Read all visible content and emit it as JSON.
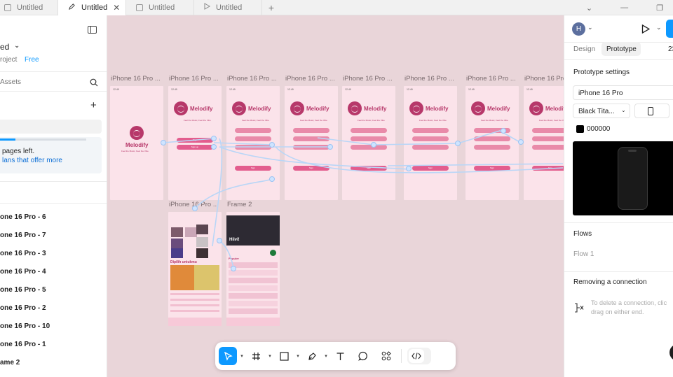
{
  "tabs": [
    {
      "label": "Untitled",
      "active": false,
      "icon": "draft-icon"
    },
    {
      "label": "Untitled",
      "active": true,
      "icon": "pen-icon"
    },
    {
      "label": "Untitled",
      "active": false,
      "icon": "draft-icon"
    },
    {
      "label": "Untitled",
      "active": false,
      "icon": "play-icon"
    }
  ],
  "left_panel": {
    "file_name": "ed",
    "project": "roject",
    "plan_badge": "Free",
    "assets_label": "Assets",
    "notice_line1": "pages left.",
    "notice_link": "lans that offer more",
    "layers": [
      "one 16 Pro - 6",
      "one 16 Pro - 7",
      "one 16 Pro - 3",
      "one 16 Pro - 4",
      "one 16 Pro - 5",
      "one 16 Pro - 2",
      "one 16 Pro - 10",
      "one 16 Pro - 1",
      "ame 2"
    ]
  },
  "canvas": {
    "frame_labels": [
      "iPhone 16 Pro ...",
      "iPhone 16 Pro ...",
      "iPhone 16 Pro ...",
      "iPhone 16 Pro ...",
      "iPhone 16 Pro ...",
      "iPhone 16 Pro ...",
      "iPhone 16 Pro ...",
      "iPhone 16 Pro"
    ],
    "row2_labels": [
      "iPhone 16 Pro ...",
      "Frame 2"
    ],
    "brand": "Melodify",
    "tagline": "Feel the Music, Feel the Vibe",
    "status_time": "12.49",
    "btn_sign": "Sign",
    "btn_signup": "Sign up",
    "section_pilihan": "Dipilih untukmu",
    "section_populer": "Populer",
    "hiv_text": "Hiivi!"
  },
  "toolbar": {
    "tools": [
      "move-tool-icon",
      "frame-tool-icon",
      "shape-tool-icon",
      "pen-tool-icon",
      "text-tool-icon",
      "comment-tool-icon",
      "components-icon",
      "dev-mode-icon"
    ]
  },
  "right_panel": {
    "avatar_letter": "H",
    "tab_design": "Design",
    "tab_prototype": "Prototype",
    "zoom_partial": "23",
    "proto_settings": "Prototype settings",
    "device": "iPhone 16 Pro",
    "model": "Black Tita...",
    "color_hex": "000000",
    "flows_title": "Flows",
    "flow_item": "Flow 1",
    "removing_title": "Removing a connection",
    "removing_help1": "To delete a connection, clic",
    "removing_help2": "drag on either end."
  },
  "colors": {
    "canvas_bg": "#e9d5d9",
    "accent": "#0d99ff",
    "brand_pink": "#b7386a",
    "screen_pink": "#fbe3ea"
  }
}
